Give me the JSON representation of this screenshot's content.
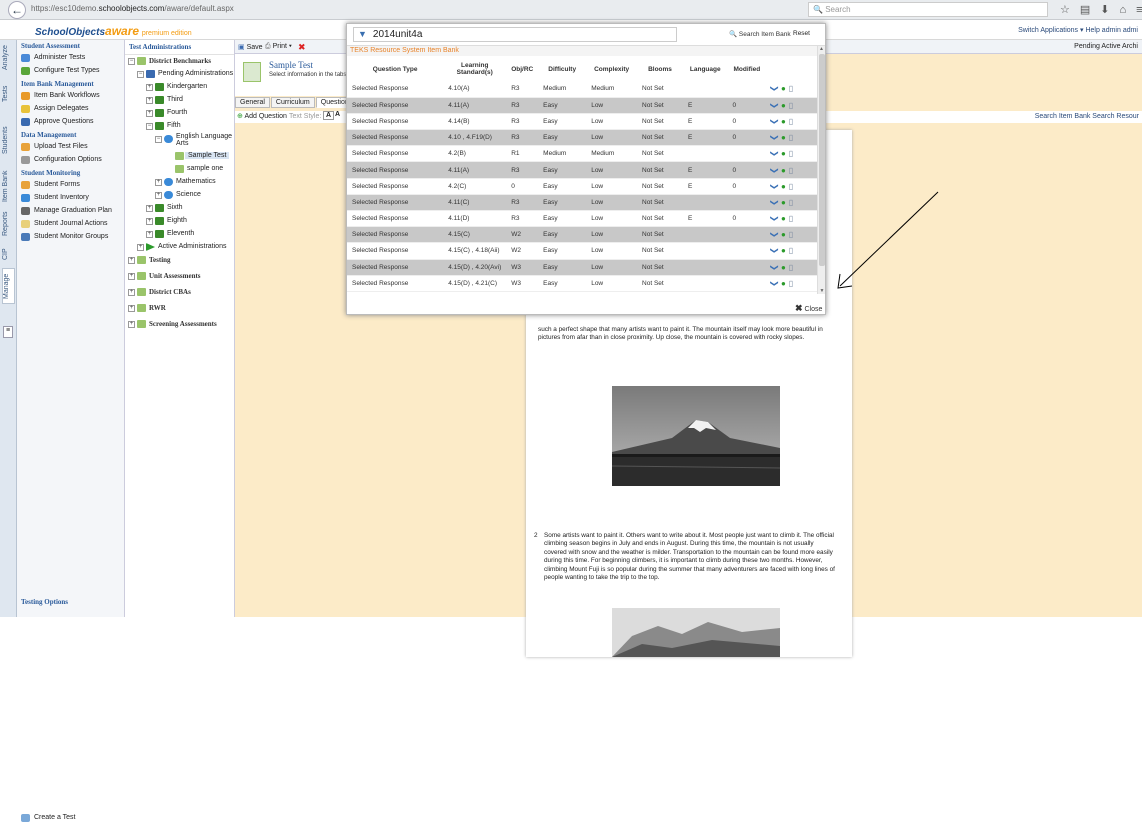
{
  "browser": {
    "url_prefix": "https://esc10demo.",
    "url_domain": "schoolobjects.com",
    "url_suffix": "/aware/default.aspx",
    "search_placeholder": "Search"
  },
  "header": {
    "brand": "SchoolObjects",
    "brand_aware": "aware",
    "edition": "premium edition",
    "links": "Switch Applications ▾   Help   admin admi"
  },
  "left_rail": [
    "Analyze",
    "Tests",
    "Students",
    "Item Bank",
    "Reports",
    "CIP",
    "Manage"
  ],
  "side_nav": {
    "sections": [
      {
        "title": "Student Assessment",
        "items": [
          "Administer Tests",
          "Configure Test Types"
        ]
      },
      {
        "title": "Item Bank Management",
        "items": [
          "Item Bank Workflows",
          "Assign Delegates",
          "Approve Questions"
        ]
      },
      {
        "title": "Data Management",
        "items": [
          "Upload Test Files",
          "Configuration Options"
        ]
      },
      {
        "title": "Student Monitoring",
        "items": [
          "Student Forms",
          "Student Inventory",
          "Manage Graduation Plan",
          "Student Journal Actions",
          "Student Monitor Groups"
        ]
      }
    ],
    "testing_options_title": "Testing Options",
    "create_test": "Create a Test"
  },
  "test_admin": {
    "title": "Test Administrations",
    "tree": {
      "district_benchmarks": "District Benchmarks",
      "pending_administrations": "Pending Administrations",
      "kindergarten": "Kindergarten",
      "third": "Third",
      "fourth": "Fourth",
      "fifth": "Fifth",
      "ela_1": "English Language",
      "ela_2": "Arts",
      "sample_test": "Sample Test",
      "sample_one": "sample one",
      "mathematics": "Mathematics",
      "science": "Science",
      "sixth": "Sixth",
      "eighth": "Eighth",
      "eleventh": "Eleventh",
      "active_admins": "Active Administrations",
      "testing": "Testing",
      "unit_assessments": "Unit Assessments",
      "district_cbas": "District CBAs",
      "rwr": "RWR",
      "screening": "Screening Assessments"
    }
  },
  "main": {
    "toolbar_save": "Save",
    "toolbar_print": "Print ▾",
    "toolbar_right": "Pending   Active   Archi",
    "sample_title": "Sample Test",
    "sample_desc": "Select information in the tabs",
    "tabs": [
      "General",
      "Curriculum",
      "Questions"
    ],
    "add_question": "Add Question",
    "text_style": "Text Style:",
    "search_links": "Search Item Bank   Search Resour",
    "doc_text_1": "such a perfect shape that many artists want to paint it. The mountain itself may look more beautiful in pictures from afar than in close proximity. Up close, the mountain is covered with rocky slopes.",
    "doc_num_2": "2",
    "doc_text_2": "Some artists want to paint it. Others want to write about it. Most people just want to climb it. The official climbing season begins in July and ends in August. During this time, the mountain is not usually covered with snow and the weather is milder. Transportation to the mountain can be found more easily during this time. For beginning climbers, it is important to climb during these two months. However, climbing Mount Fuji is so popular during the summer that many adventurers are faced with long lines of people wanting to take the trip to the top."
  },
  "modal": {
    "search_value": "2014unit4a",
    "search_btn": "Search Item Bank",
    "reset_btn": "Reset",
    "title": "TEKS Resource System Item Bank",
    "columns": [
      "Question Type",
      "Learning Standard(s)",
      "Obj/RC",
      "Difficulty",
      "Complexity",
      "Blooms",
      "Language",
      "Modified"
    ],
    "rows": [
      [
        "Selected Response",
        "4.10(A)",
        "R3",
        "Medium",
        "Medium",
        "Not Set",
        "",
        ""
      ],
      [
        "Selected Response",
        "4.11(A)",
        "R3",
        "Easy",
        "Low",
        "Not Set",
        "E",
        "0"
      ],
      [
        "Selected Response",
        "4.14(B)",
        "R3",
        "Easy",
        "Low",
        "Not Set",
        "E",
        "0"
      ],
      [
        "Selected Response",
        "4.10 , 4.F19(D)",
        "R3",
        "Easy",
        "Low",
        "Not Set",
        "E",
        "0"
      ],
      [
        "Selected Response",
        "4.2(B)",
        "R1",
        "Medium",
        "Medium",
        "Not Set",
        "",
        ""
      ],
      [
        "Selected Response",
        "4.11(A)",
        "R3",
        "Easy",
        "Low",
        "Not Set",
        "E",
        "0"
      ],
      [
        "Selected Response",
        "4.2(C)",
        "0",
        "Easy",
        "Low",
        "Not Set",
        "E",
        "0"
      ],
      [
        "Selected Response",
        "4.11(C)",
        "R3",
        "Easy",
        "Low",
        "Not Set",
        "",
        ""
      ],
      [
        "Selected Response",
        "4.11(D)",
        "R3",
        "Easy",
        "Low",
        "Not Set",
        "E",
        "0"
      ],
      [
        "Selected Response",
        "4.15(C)",
        "W2",
        "Easy",
        "Low",
        "Not Set",
        "",
        ""
      ],
      [
        "Selected Response",
        "4.15(C) , 4.18(Aii)",
        "W2",
        "Easy",
        "Low",
        "Not Set",
        "",
        ""
      ],
      [
        "Selected Response",
        "4.15(D) , 4.20(Avi)",
        "W3",
        "Easy",
        "Low",
        "Not Set",
        "",
        ""
      ],
      [
        "Selected Response",
        "4.15(D) , 4.21(C)",
        "W3",
        "Easy",
        "Low",
        "Not Set",
        "",
        ""
      ]
    ],
    "close_label": "Close"
  }
}
